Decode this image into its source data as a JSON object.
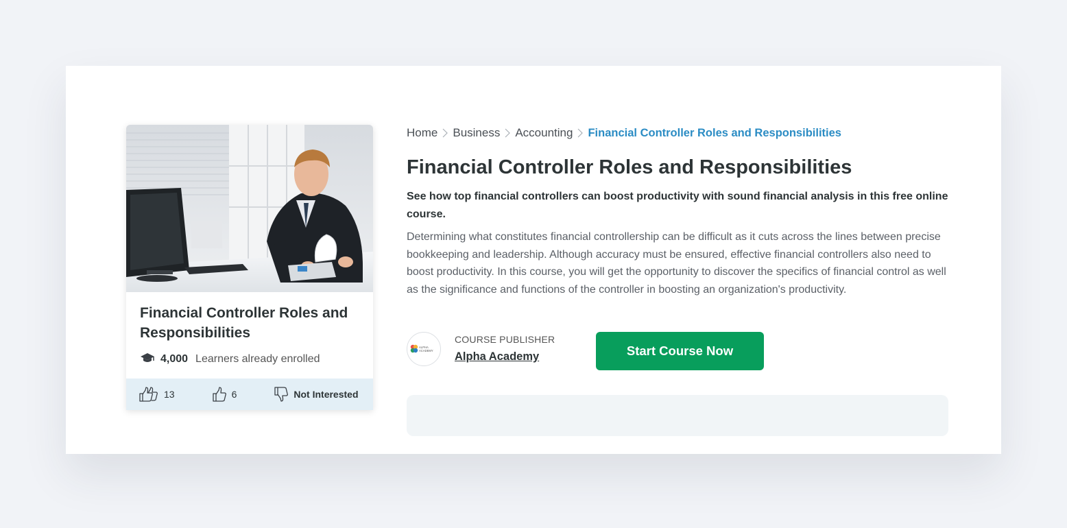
{
  "card": {
    "title": "Financial Controller Roles and Responsibilities",
    "enrolled_count": "4,000",
    "enrolled_text": "Learners already enrolled",
    "like_count": "13",
    "thumb_count": "6",
    "not_interested_label": "Not Interested"
  },
  "breadcrumb": {
    "items": [
      "Home",
      "Business",
      "Accounting"
    ],
    "current": "Financial Controller Roles and Responsibilities"
  },
  "course": {
    "title": "Financial Controller Roles and Responsibilities",
    "subtitle": "See how top financial controllers can boost productivity with sound financial analysis in this free online course.",
    "description": "Determining what constitutes financial controllership can be difficult as it cuts across the lines between precise bookkeeping and leadership. Although accuracy must be ensured, effective financial controllers also need to boost productivity. In this course, you will get the opportunity to discover the specifics of financial control as well as the significance and functions of the controller in boosting an organization's productivity."
  },
  "publisher": {
    "label": "COURSE PUBLISHER",
    "name": "Alpha Academy",
    "logo_text": "ALPHA ACADEMY"
  },
  "actions": {
    "start_label": "Start Course Now"
  },
  "colors": {
    "accent_green": "#089e5c",
    "link_blue": "#2b8cc4",
    "footer_bg": "#e3eff6"
  }
}
